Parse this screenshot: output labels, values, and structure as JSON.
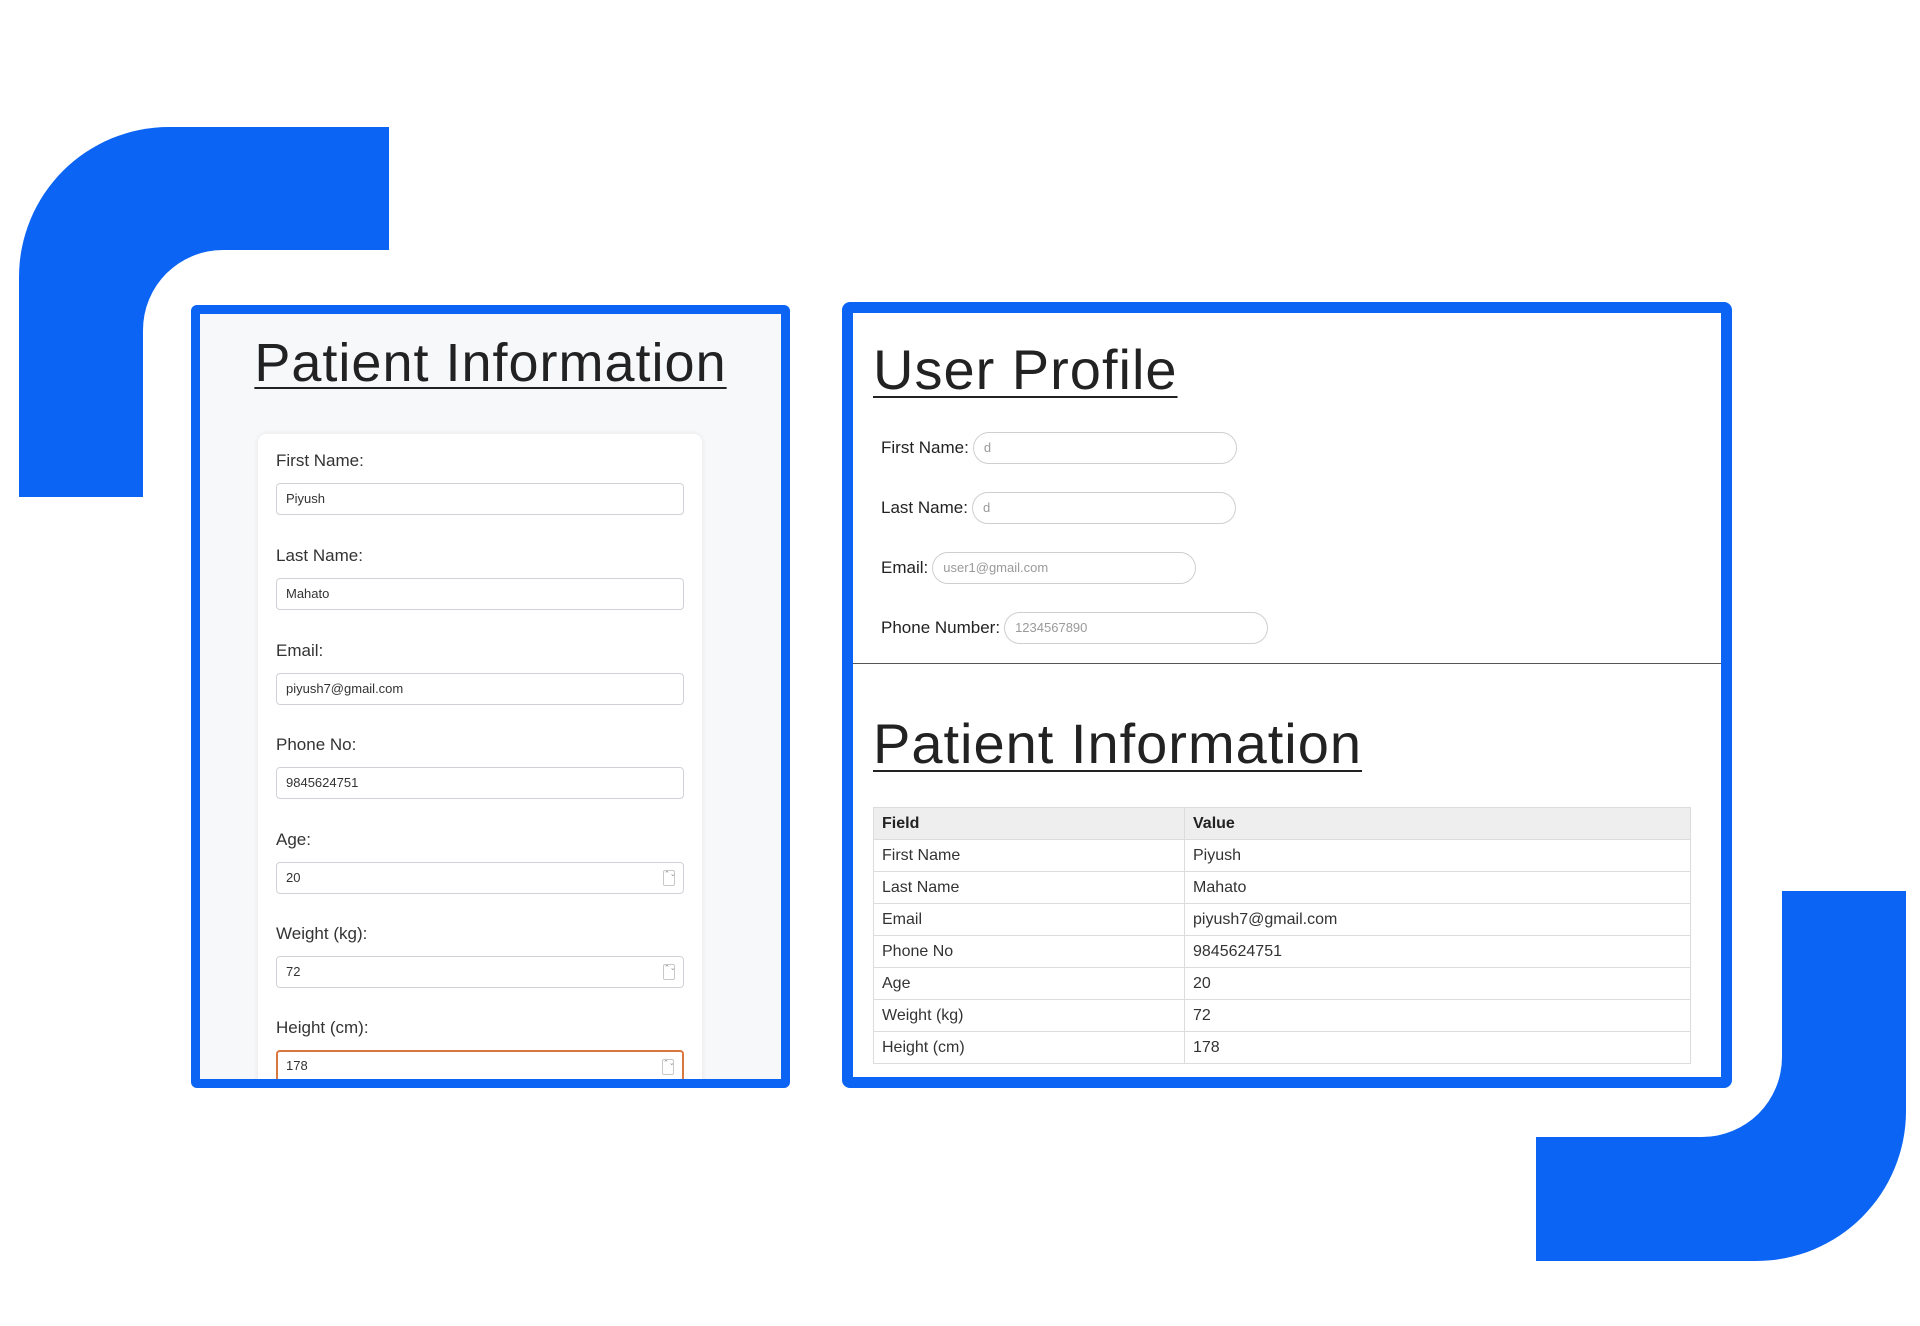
{
  "colors": {
    "accent": "#0b64f4",
    "focus_border": "#d9773f",
    "divider": "#555555"
  },
  "patient_form": {
    "title": "Patient Information",
    "fields": [
      {
        "label": "First Name:",
        "value": "Piyush"
      },
      {
        "label": "Last Name:",
        "value": "Mahato"
      },
      {
        "label": "Email:",
        "value": "piyush7@gmail.com"
      },
      {
        "label": "Phone No:",
        "value": "9845624751"
      },
      {
        "label": "Age:",
        "value": "20",
        "spinner": true
      },
      {
        "label": "Weight (kg):",
        "value": "72",
        "spinner": true
      },
      {
        "label": "Height (cm):",
        "value": "178",
        "spinner": true,
        "focused": true
      }
    ],
    "spinner_glyph": "⌃⌄"
  },
  "user_profile": {
    "title": "User Profile",
    "fields": [
      {
        "label": "First Name:",
        "placeholder": "d"
      },
      {
        "label": "Last Name:",
        "placeholder": "d"
      },
      {
        "label": "Email:",
        "placeholder": "user1@gmail.com"
      },
      {
        "label": "Phone Number:",
        "placeholder": "1234567890"
      }
    ]
  },
  "patient_table": {
    "title": "Patient Information",
    "headers": [
      "Field",
      "Value"
    ],
    "rows": [
      [
        "First Name",
        "Piyush"
      ],
      [
        "Last Name",
        "Mahato"
      ],
      [
        "Email",
        "piyush7@gmail.com"
      ],
      [
        "Phone No",
        "9845624751"
      ],
      [
        "Age",
        "20"
      ],
      [
        "Weight (kg)",
        "72"
      ],
      [
        "Height (cm)",
        "178"
      ]
    ]
  }
}
